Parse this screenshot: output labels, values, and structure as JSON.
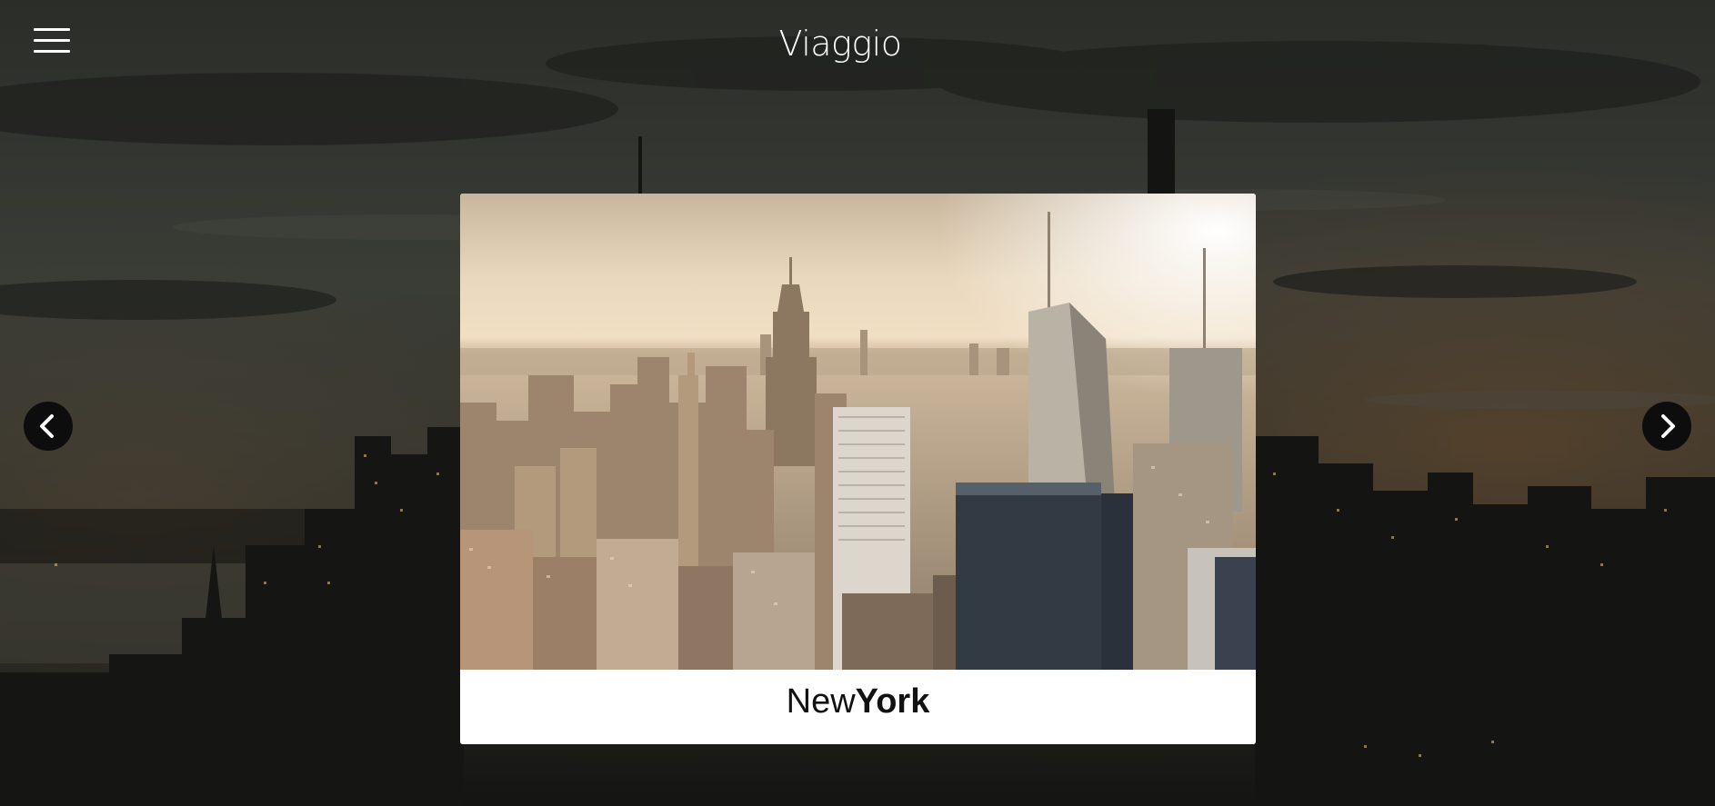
{
  "header": {
    "brand": "Viaggio",
    "menu_icon": "hamburger-menu-icon"
  },
  "carousel": {
    "prev_icon": "chevron-left-icon",
    "next_icon": "chevron-right-icon",
    "current_slide": {
      "city_regular": "New",
      "city_bold": "York"
    }
  },
  "colors": {
    "overlay": "#1b1c1a",
    "nav_button": "#0d0d0d",
    "caption_bg": "#ffffff",
    "caption_text": "#111111",
    "sky_warm": "#f6e7cf"
  }
}
